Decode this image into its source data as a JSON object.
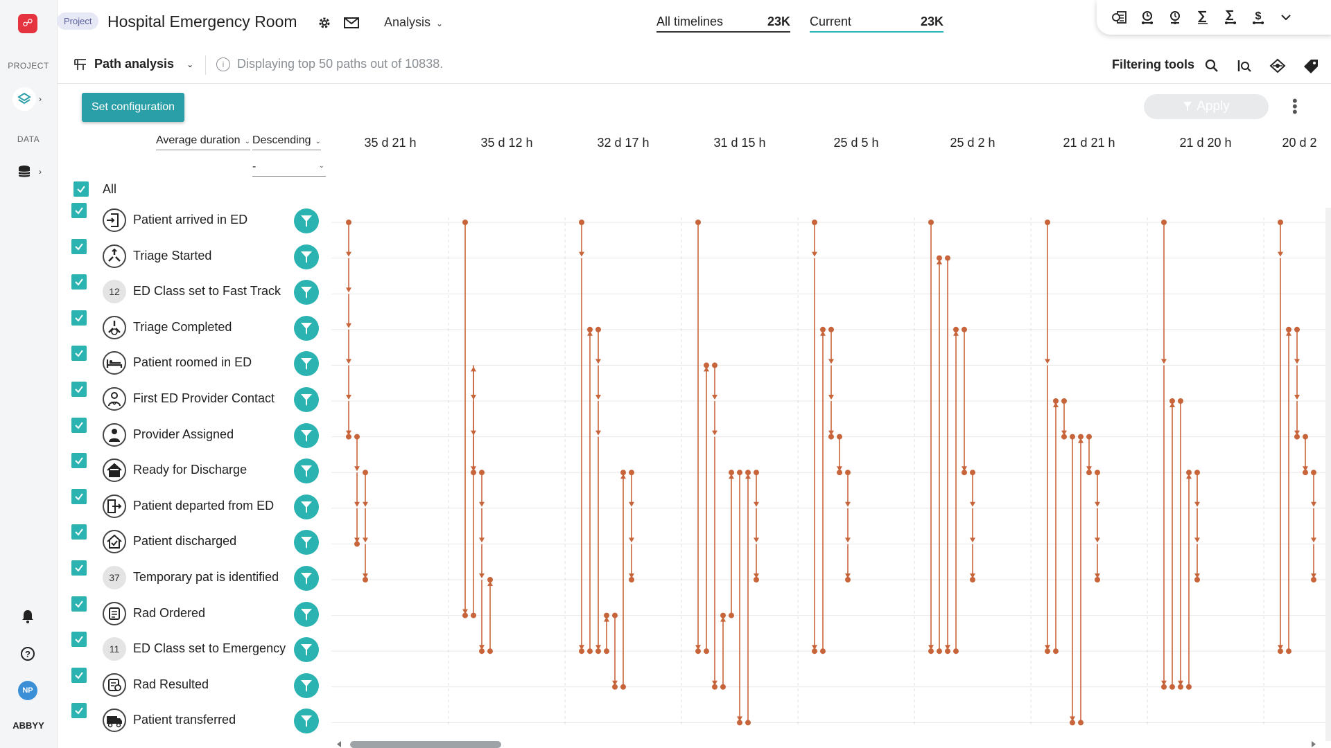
{
  "leftnav": {
    "project_label": "PROJECT",
    "data_label": "DATA",
    "avatar_initials": "NP",
    "brand": "ABBYY"
  },
  "header": {
    "badge": "Project",
    "title": "Hospital Emergency Room",
    "analysis_label": "Analysis",
    "all_timelines_label": "All timelines",
    "all_timelines_count": "23K",
    "current_label": "Current",
    "current_count": "23K"
  },
  "subheader": {
    "view_label": "Path analysis",
    "info_text": "Displaying top 50 paths out of 10838.",
    "filtering_tools_label": "Filtering tools"
  },
  "controls": {
    "set_configuration": "Set configuration",
    "apply": "Apply",
    "sort_by": "Average duration",
    "sort_order": "Descending",
    "secondary_sort": "-",
    "all_label": "All"
  },
  "events": [
    {
      "label": "Patient arrived in ED",
      "icon": "arrive-door-icon"
    },
    {
      "label": "Triage Started",
      "icon": "triage-start-icon"
    },
    {
      "label": "ED Class set to Fast Track",
      "badge": "12"
    },
    {
      "label": "Triage Completed",
      "icon": "triage-done-icon"
    },
    {
      "label": "Patient roomed in ED",
      "icon": "bed-icon"
    },
    {
      "label": "First ED Provider Contact",
      "icon": "doctor-icon"
    },
    {
      "label": "Provider Assigned",
      "icon": "doctor-assigned-icon"
    },
    {
      "label": "Ready for Discharge",
      "icon": "home-icon"
    },
    {
      "label": "Patient departed from ED",
      "icon": "depart-door-icon"
    },
    {
      "label": "Patient discharged",
      "icon": "home-check-icon"
    },
    {
      "label": "Temporary pat is identified",
      "badge": "37"
    },
    {
      "label": "Rad Ordered",
      "icon": "rad-order-icon"
    },
    {
      "label": "ED Class set to Emergency",
      "badge": "11"
    },
    {
      "label": "Rad Resulted",
      "icon": "rad-result-icon"
    },
    {
      "label": "Patient transferred",
      "icon": "ambulance-icon"
    }
  ],
  "chart_data": {
    "type": "path-diagram",
    "accent_color": "#c8643a",
    "path_durations": [
      "35 d 21 h",
      "35 d 12 h",
      "32 d 17 h",
      "31 d 15 h",
      "25 d 5 h",
      "25 d 2 h",
      "21 d 21 h",
      "21 d 20 h",
      "20 d 2"
    ],
    "paths": [
      {
        "duration": "35 d 21 h",
        "lanes": [
          [
            0,
            1,
            2,
            3,
            4,
            5,
            6
          ],
          [
            6,
            7,
            8,
            9
          ],
          [
            7,
            8,
            9,
            10
          ]
        ]
      },
      {
        "duration": "35 d 12 h",
        "lanes": [
          [
            0,
            11
          ],
          [
            11,
            4,
            5,
            6,
            7
          ],
          [
            7,
            8,
            9,
            10,
            12
          ],
          [
            12,
            10
          ]
        ]
      },
      {
        "duration": "32 d 17 h",
        "lanes": [
          [
            0,
            1,
            12
          ],
          [
            12,
            3
          ],
          [
            3,
            4,
            5,
            6,
            12
          ],
          [
            12,
            11
          ],
          [
            11,
            13
          ],
          [
            13,
            7
          ],
          [
            7,
            8,
            9,
            10
          ]
        ]
      },
      {
        "duration": "31 d 15 h",
        "lanes": [
          [
            0,
            12
          ],
          [
            12,
            4
          ],
          [
            4,
            5,
            6,
            13
          ],
          [
            13,
            11
          ],
          [
            11,
            7
          ],
          [
            7,
            14
          ],
          [
            14,
            7
          ],
          [
            7,
            8,
            9,
            10
          ]
        ]
      },
      {
        "duration": "25 d 5 h",
        "lanes": [
          [
            0,
            1,
            12
          ],
          [
            12,
            3
          ],
          [
            3,
            4,
            5,
            6
          ],
          [
            6,
            7
          ],
          [
            7,
            8,
            9,
            10
          ]
        ]
      },
      {
        "duration": "25 d 2 h",
        "lanes": [
          [
            0,
            12
          ],
          [
            12,
            1
          ],
          [
            1,
            12
          ],
          [
            12,
            3
          ],
          [
            3,
            7
          ],
          [
            7,
            8,
            9,
            10
          ]
        ]
      },
      {
        "duration": "21 d 21 h",
        "lanes": [
          [
            0,
            4,
            12
          ],
          [
            12,
            5
          ],
          [
            5,
            6
          ],
          [
            6,
            14
          ],
          [
            14,
            6
          ],
          [
            6,
            7
          ],
          [
            7,
            8,
            9,
            10
          ]
        ]
      },
      {
        "duration": "21 d 20 h",
        "lanes": [
          [
            0,
            4,
            13
          ],
          [
            13,
            5
          ],
          [
            5,
            13
          ],
          [
            13,
            7
          ],
          [
            7,
            8,
            9,
            10
          ]
        ]
      },
      {
        "duration": "20 d 2",
        "lanes": [
          [
            0,
            1,
            12
          ],
          [
            12,
            3
          ],
          [
            3,
            4,
            5,
            6
          ],
          [
            6,
            7
          ],
          [
            7,
            8,
            9,
            10
          ]
        ]
      }
    ]
  }
}
